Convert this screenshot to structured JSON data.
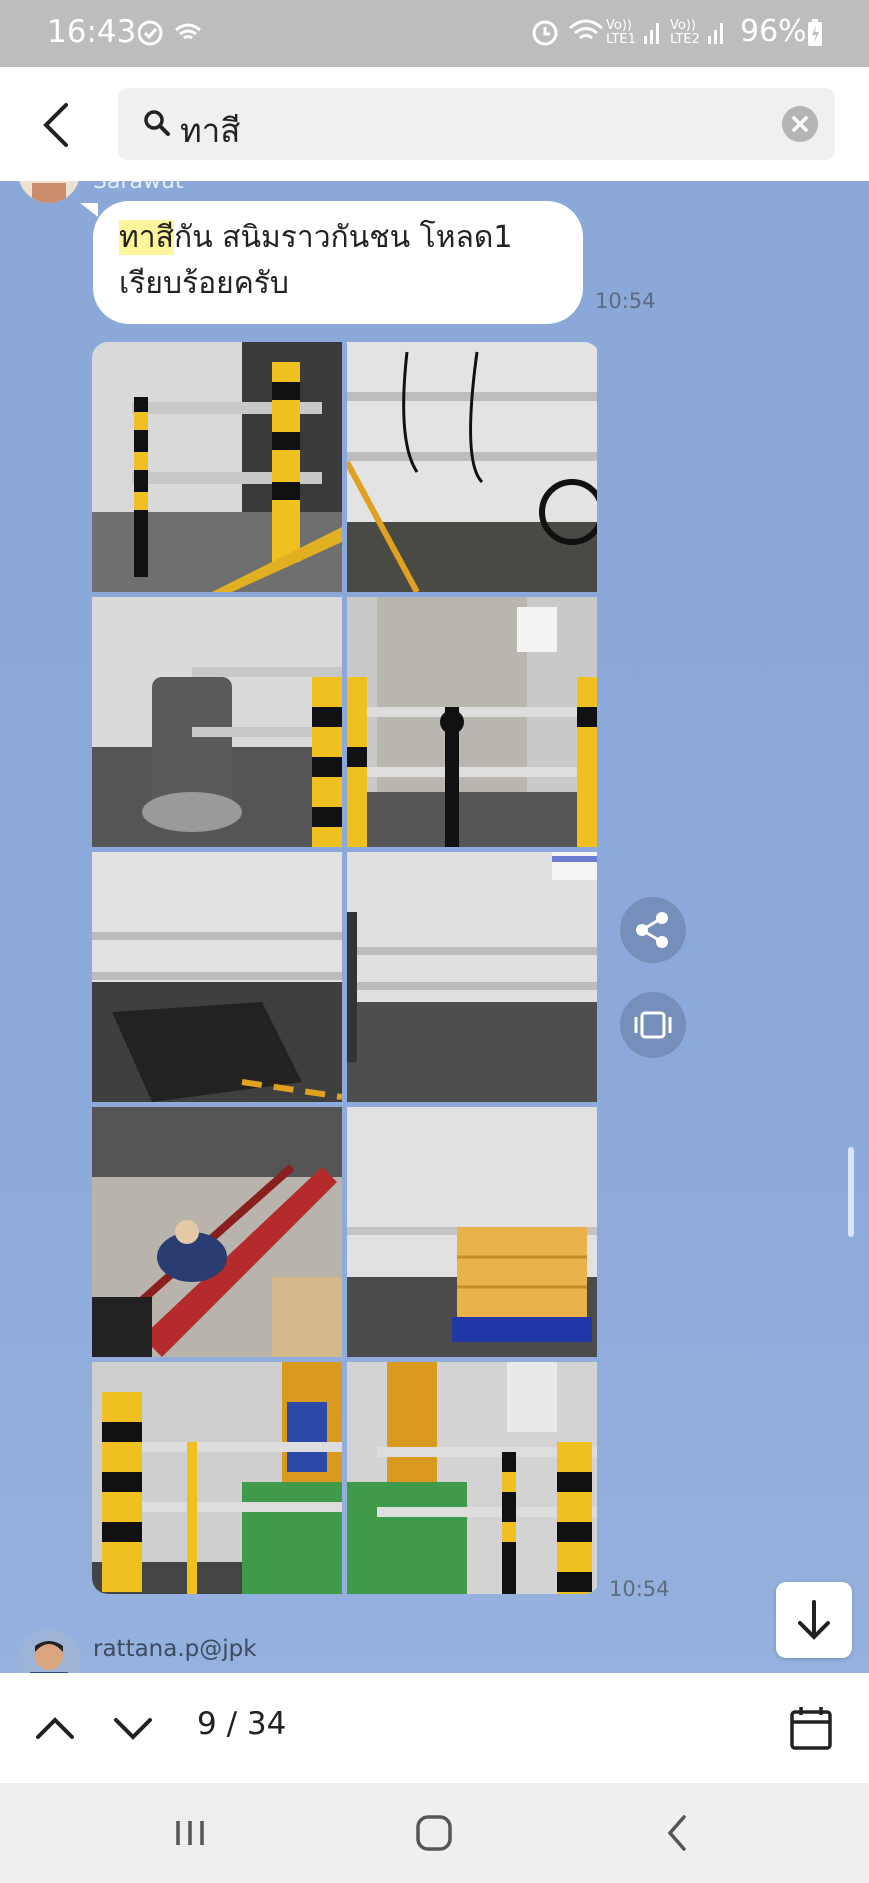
{
  "status_bar": {
    "time": "16:43",
    "network_labels": "Vo)) LTE1 Vo)) LTE2",
    "battery": "96%"
  },
  "search": {
    "query": "ทาสี"
  },
  "messages": [
    {
      "sender": "Sarawut",
      "text_highlight": "ทาสี",
      "text_rest": "กัน สนิมราวกันชน โหลด1 เรียบร้อยครับ",
      "time": "10:54"
    },
    {
      "type": "photo-grid",
      "photos": [
        {
          "name": "Yellow-black pole and rail"
        },
        {
          "name": "Rail with hanging cables"
        },
        {
          "name": "Floor scrubber near rail"
        },
        {
          "name": "Black joint on rail"
        },
        {
          "name": "Long wall rail"
        },
        {
          "name": "Wall rail corner"
        },
        {
          "name": "Worker painting red rails"
        },
        {
          "name": "Boxes on blue pallet"
        },
        {
          "name": "Painted corner guard"
        },
        {
          "name": "Painted rail near panel"
        }
      ],
      "time": "10:54"
    },
    {
      "sender": "rattana.p@jpk"
    }
  ],
  "bottom_bar": {
    "counter": "9 / 34"
  },
  "icons": {
    "back": "back-arrow-icon",
    "search": "search-icon",
    "clear": "clear-icon",
    "share": "share-icon",
    "gallery": "gallery-icon",
    "scroll_down": "arrow-down-icon",
    "prev": "chevron-up-icon",
    "next": "chevron-down-icon",
    "calendar": "calendar-icon"
  },
  "colors": {
    "chat_bg": "#8ba9d9",
    "highlight": "#fff59a",
    "status_bar": "#bdbdbd"
  }
}
